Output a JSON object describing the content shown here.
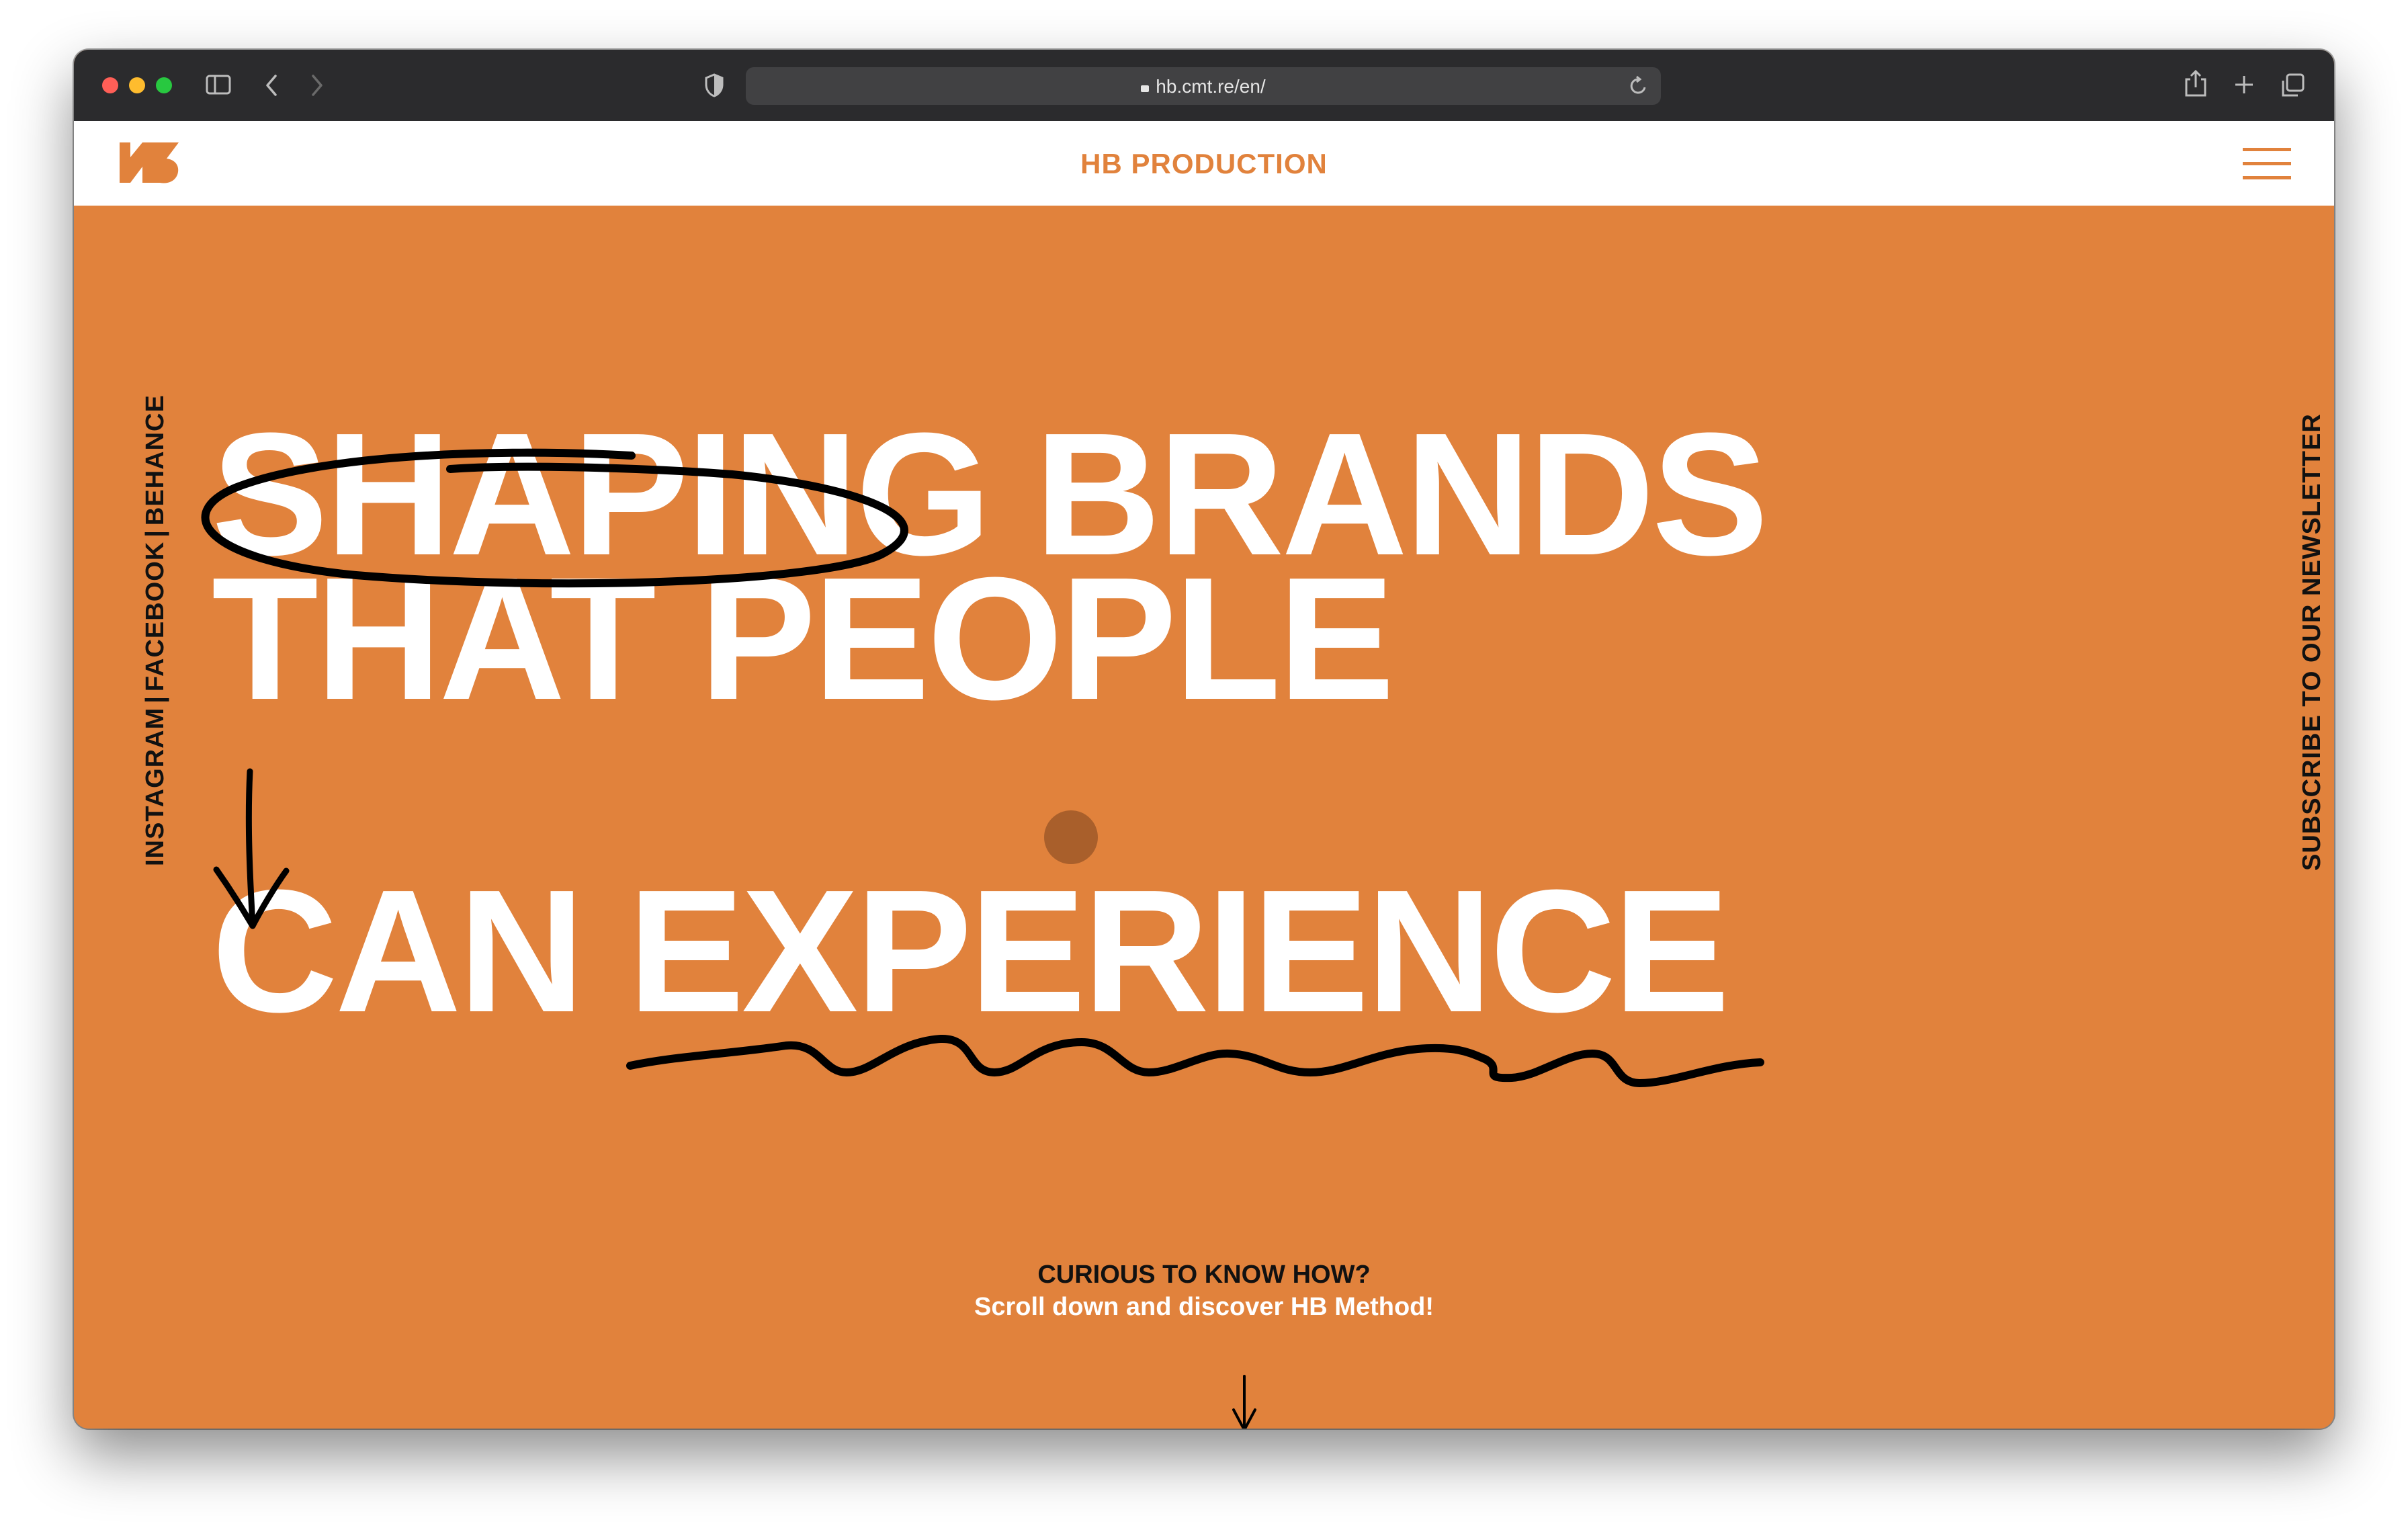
{
  "browser": {
    "url": "hb.cmt.re/en/"
  },
  "header": {
    "title": "HB PRODUCTION",
    "logo_text": "HB"
  },
  "hero": {
    "line1_word1": "SHAPING",
    "line1_word2": "BRANDS",
    "line2": "THAT PEOPLE",
    "line3_word1": "CAN",
    "line3_word2": "EXPERIENCE"
  },
  "social": {
    "instagram": "INSTAGRAM",
    "facebook": "FACEBOOK",
    "behance": "BEHANCE",
    "separator": "|"
  },
  "newsletter": "SUBSCRIBE TO OUR NEWSLETTER",
  "cta": {
    "title": "CURIOUS TO KNOW HOW?",
    "subtitle": "Scroll down and discover HB Method!"
  },
  "colors": {
    "accent": "#e1823c",
    "dot": "#a95f2b",
    "ink": "#111111"
  }
}
